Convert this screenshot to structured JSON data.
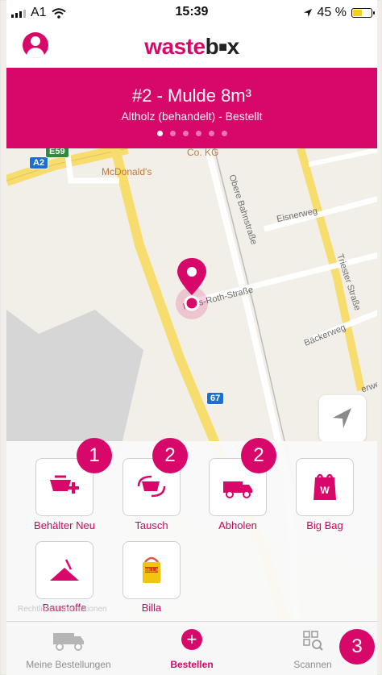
{
  "status_bar": {
    "carrier": "A1",
    "time": "15:39",
    "battery": "45 %",
    "battery_level": 0.45,
    "icons": [
      "signal-icon",
      "wifi-icon",
      "location-arrow-icon",
      "battery-icon"
    ]
  },
  "header": {
    "logo_prefix": "waste",
    "logo_mid": "b",
    "logo_box": "■",
    "logo_suffix": "x",
    "avatar_icon": "user-icon"
  },
  "order": {
    "title": "#2 - Mulde 8m³",
    "subtitle": "Altholz (behandelt) - Bestellt",
    "page_count": 6,
    "active_page": 1
  },
  "map": {
    "labels": {
      "mcdonalds": "McDonald's",
      "co_kg": "Co. KG",
      "obere_bahnstrasse": "Obere Bahnstraße",
      "eisnerweg": "Eisnerweg",
      "hans_roth_strasse": "Hans-Roth-Straße",
      "triester_strasse": "Triester Straße",
      "baeckerweg": "Bäckerweg",
      "erwe": "erwe",
      "road_67": "67",
      "road_a2": "A2",
      "road_e": "E59",
      "legal": "Rechtliche Informationen"
    },
    "colors": {
      "road_major": "#f7dd6e",
      "road_minor": "#ffffff",
      "land": "#f2efe8",
      "water": "#d6d6d6"
    }
  },
  "actions": [
    {
      "label": "Behälter Neu",
      "icon": "new-container-icon",
      "badge": "1"
    },
    {
      "label": "Tausch",
      "icon": "swap-container-icon",
      "badge": "2"
    },
    {
      "label": "Abholen",
      "icon": "pickup-truck-icon",
      "badge": "2"
    },
    {
      "label": "Big Bag",
      "icon": "big-bag-icon",
      "badge": ""
    },
    {
      "label": "Baustoffe",
      "icon": "building-materials-icon",
      "badge": ""
    },
    {
      "label": "Billa",
      "icon": "billa-bag-icon",
      "badge": ""
    }
  ],
  "tabs": [
    {
      "label": "Meine Bestellungen",
      "icon": "truck-icon",
      "active": false
    },
    {
      "label": "Bestellen",
      "icon": "plus-circle-icon",
      "active": true
    },
    {
      "label": "Scannen",
      "icon": "qr-scan-icon",
      "active": false,
      "badge": "3"
    }
  ],
  "colors": {
    "brand": "#d8086b",
    "brand_text": "#c20a5f"
  }
}
